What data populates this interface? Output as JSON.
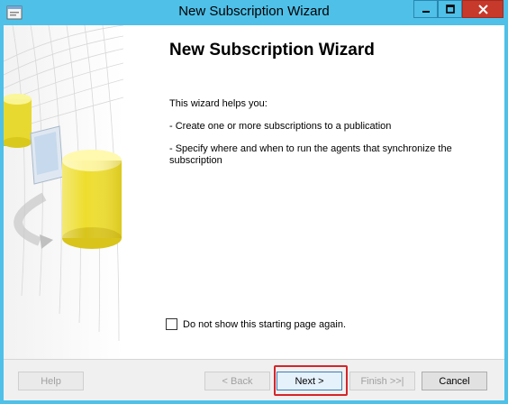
{
  "window": {
    "title": "New Subscription Wizard"
  },
  "main": {
    "heading": "New Subscription Wizard",
    "intro": "This wizard helps you:",
    "bullet1": "- Create one or more subscriptions to a publication",
    "bullet2": "- Specify where and when to run the agents that synchronize the subscription"
  },
  "checkbox": {
    "label": "Do not show this starting page again.",
    "checked": false
  },
  "buttons": {
    "help": "Help",
    "back": "< Back",
    "next": "Next >",
    "finish": "Finish >>|",
    "cancel": "Cancel"
  },
  "colors": {
    "titlebar": "#4fc0e8",
    "close_button": "#c7392b",
    "highlight": "#d4252a"
  },
  "icons": [
    "app-icon",
    "minimize-icon",
    "maximize-icon",
    "close-icon",
    "database-wizard-illustration"
  ]
}
